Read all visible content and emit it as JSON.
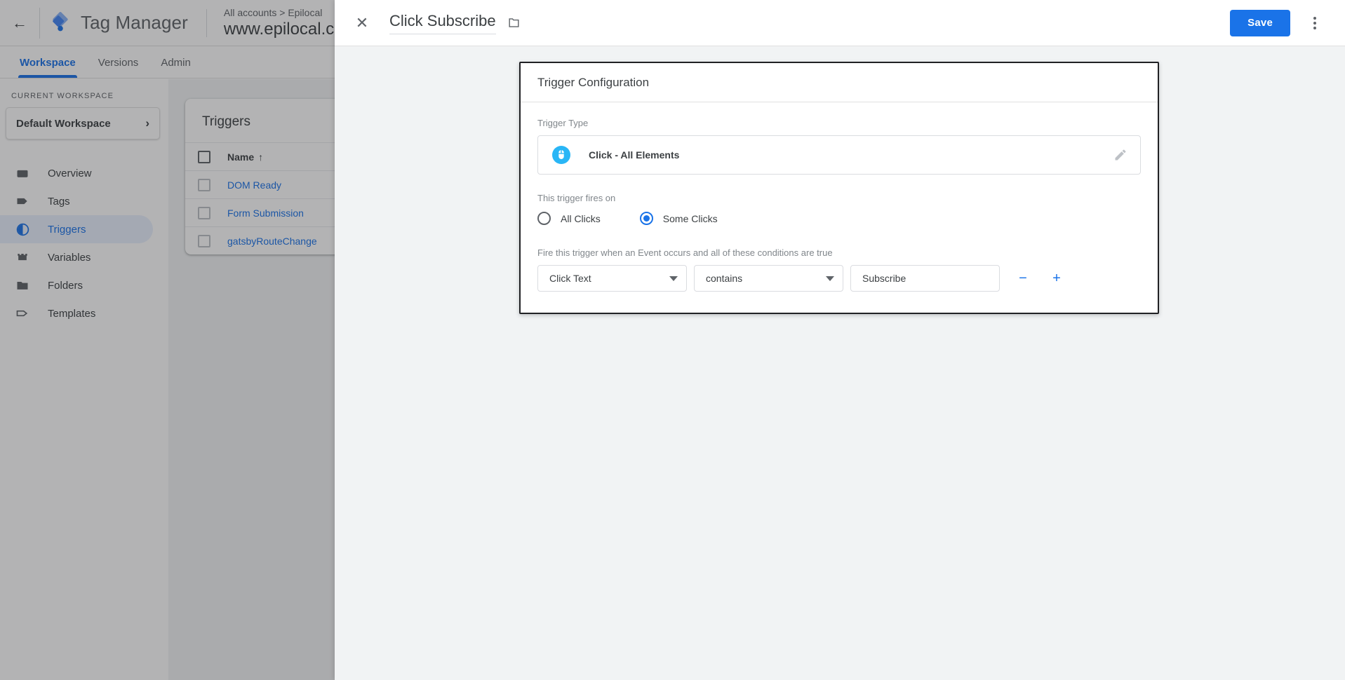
{
  "app": {
    "back_arrow": "←",
    "product_name": "Tag Manager",
    "account_breadcrumb": "All accounts > Epilocal",
    "container_name": "www.epilocal.com",
    "tabs": [
      {
        "label": "Workspace",
        "active": true
      },
      {
        "label": "Versions",
        "active": false
      },
      {
        "label": "Admin",
        "active": false
      }
    ]
  },
  "sidebar": {
    "section_label": "CURRENT WORKSPACE",
    "workspace_name": "Default Workspace",
    "workspace_chevron": "›",
    "items": [
      {
        "label": "Overview",
        "icon": "overview-icon",
        "selected": false
      },
      {
        "label": "Tags",
        "icon": "tag-icon",
        "selected": false
      },
      {
        "label": "Triggers",
        "icon": "trigger-icon",
        "selected": true
      },
      {
        "label": "Variables",
        "icon": "variables-icon",
        "selected": false
      },
      {
        "label": "Folders",
        "icon": "folder-icon",
        "selected": false
      },
      {
        "label": "Templates",
        "icon": "template-icon",
        "selected": false
      }
    ]
  },
  "triggers_panel": {
    "title": "Triggers",
    "column_header": "Name",
    "sort_arrow": "↑",
    "rows": [
      {
        "name": "DOM Ready"
      },
      {
        "name": "Form Submission"
      },
      {
        "name": "gatsbyRouteChange"
      }
    ]
  },
  "modal": {
    "close_label": "✕",
    "title": "Click Subscribe",
    "folder_icon": "folder-icon",
    "save_label": "Save",
    "more_menu": "more-options-icon",
    "card": {
      "heading": "Trigger Configuration",
      "trigger_type_label": "Trigger Type",
      "trigger_type_value": "Click - All Elements",
      "trigger_type_icon": "mouse-click-icon",
      "edit_icon": "pencil-icon",
      "fires_on_label": "This trigger fires on",
      "radio_options": [
        {
          "label": "All Clicks",
          "checked": false
        },
        {
          "label": "Some Clicks",
          "checked": true
        }
      ],
      "conditions_label": "Fire this trigger when an Event occurs and all of these conditions are true",
      "condition": {
        "variable": "Click Text",
        "operator": "contains",
        "value": "Subscribe",
        "value_placeholder": "",
        "remove_label": "−",
        "add_label": "+"
      }
    }
  },
  "colors": {
    "accent_blue": "#1a73e8",
    "trigger_icon_cyan": "#29b6f6",
    "text_primary": "#3c4043",
    "text_secondary": "#80868b",
    "panel_bg": "#f1f3f4"
  }
}
